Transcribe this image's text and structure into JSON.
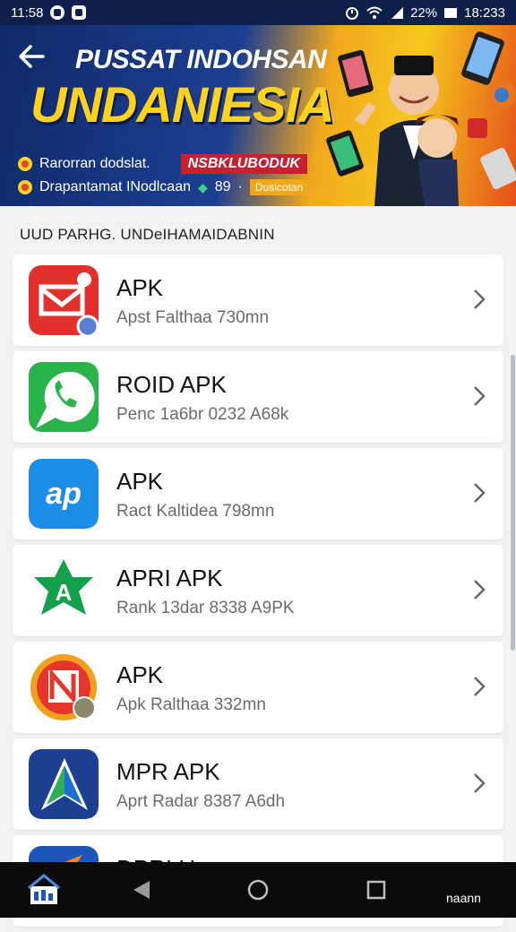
{
  "status_bar": {
    "time": "11:58",
    "battery": "22%",
    "clock_right": "18:233"
  },
  "header": {
    "title": "PUSSAT INDOHSAN",
    "big_title": "UNDANIESIA",
    "promo_line_1": "Rarorran dodslat.",
    "promo_tag_1": "NSBKLUBODUK",
    "promo_line_2": "Drapantamat INodlcaan",
    "promo_number": "89",
    "promo_tag_2": "Dusicotan"
  },
  "section": {
    "title": "UUD PARHG. UNDeIHAMAIDABNIN"
  },
  "apps": [
    {
      "name": "APK",
      "meta": "Apst Falthaa 730mn",
      "icon": "red-mail-icon",
      "color": "#e2302c"
    },
    {
      "name": "ROID APK",
      "meta": "Penc 1a6br 0232 A68k",
      "icon": "green-phone-icon",
      "color": "#2bb34b"
    },
    {
      "name": "APK",
      "meta": "Ract Kaltidea 798mn",
      "icon": "blue-ap-icon",
      "color": "#1d8ee8"
    },
    {
      "name": "APRI APK",
      "meta": "Rank 13dar 8338 A9PK",
      "icon": "green-star-icon",
      "color": "#12a04a"
    },
    {
      "name": "APK",
      "meta": "Apk Ralthaa 332mn",
      "icon": "orange-n-icon",
      "color": "#f0a01c"
    },
    {
      "name": "MPR APK",
      "meta": "Aprt Radar 8387 A6dh",
      "icon": "navy-arrow-icon",
      "color": "#1c3f8f"
    },
    {
      "name": "DPRI Hax",
      "meta": "",
      "icon": "blue-orange-icon",
      "color": "#1e55b8"
    }
  ],
  "nav": {
    "right_label": "naann"
  },
  "colors": {
    "background": "#f1f2f4",
    "status_bar": "#0d1f4a",
    "nav_bar": "#0b0b0d",
    "banner_yellow": "#ffd21f",
    "banner_navy": "#0f2a6b"
  }
}
